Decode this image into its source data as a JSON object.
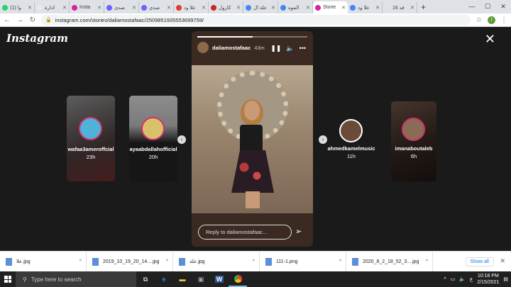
{
  "browser": {
    "tabs": [
      {
        "label": "(1) وا",
        "color": "#25d366",
        "active": false
      },
      {
        "label": "ادارة",
        "color": "#e8e8e8",
        "active": false
      },
      {
        "label": "Insta",
        "color": "#d6249f",
        "active": false
      },
      {
        "label": "صدى",
        "color": "#6b63ff",
        "active": false
      },
      {
        "label": "صدى",
        "color": "#6b63ff",
        "active": false
      },
      {
        "label": "علا ود",
        "color": "#e53935",
        "active": false
      },
      {
        "label": "كارول",
        "color": "#c62828",
        "active": false
      },
      {
        "label": "علة ال",
        "color": "#4285f4",
        "active": false
      },
      {
        "label": "الموه",
        "color": "#4285f4",
        "active": false
      },
      {
        "label": "Storie",
        "color": "#d6249f",
        "active": true
      },
      {
        "label": "علا ود",
        "color": "#4285f4",
        "active": false
      },
      {
        "label": "16 فد",
        "color": "#e0e0e0",
        "active": false
      }
    ],
    "url": "instagram.com/stories/daliamostafaac/2509851935553699759/",
    "profile_initial": "I"
  },
  "instagram": {
    "logo": "Instagram",
    "left_stories": [
      {
        "username": "wafaa3ameroffcial",
        "time": "23h"
      },
      {
        "username": "ayaabdallahofficial",
        "time": "20h"
      }
    ],
    "right_stories": [
      {
        "username": "ahmedkamelmusic",
        "time": "11h"
      },
      {
        "username": "imanaboutaleb",
        "time": "6h"
      }
    ],
    "main_story": {
      "username": "daliamostafaac",
      "time": "43m",
      "reply_placeholder": "Reply to daliamostafaac...",
      "progress": 0.5
    }
  },
  "downloads": {
    "items": [
      "علا.jpg",
      "2019_10_19_20_14....jpg",
      "علة.jpg",
      "111-1.png",
      "2020_8_2_18_52_3....jpg"
    ],
    "show_all": "Show all"
  },
  "taskbar": {
    "search_placeholder": "Type here to search",
    "time": "10:18 PM",
    "date": "2/15/2021",
    "lang": "ع"
  }
}
